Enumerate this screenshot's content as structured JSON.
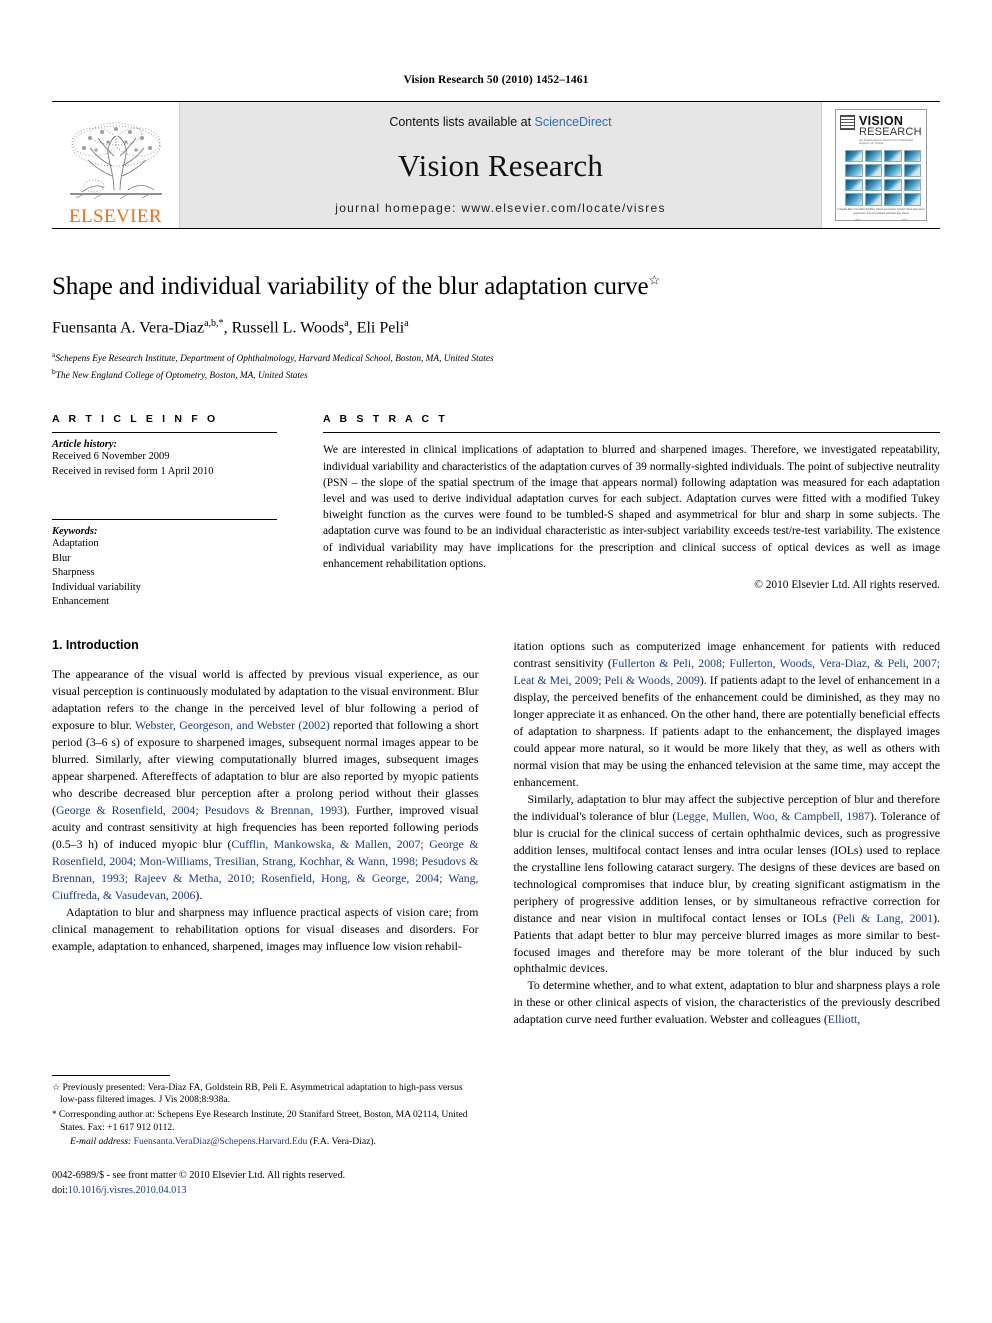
{
  "running_head": "Vision Research 50 (2010) 1452–1461",
  "masthead": {
    "publisher_name": "ELSEVIER",
    "contents_prefix": "Contents lists available at ",
    "contents_link": "ScienceDirect",
    "journal_title": "Vision Research",
    "homepage": "journal homepage: www.elsevier.com/locate/visres",
    "cover": {
      "title_line1": "VISION",
      "title_line2": "RESEARCH",
      "subtitle": "An International Journal for Functional Aspects of Vision",
      "caption": "Contents lists: Circadian rhythms, Visual perception, Spatial vision and colour appearance, Eye movements and binocular vision"
    },
    "colors": {
      "elsevier_orange": "#E8711A",
      "sciencedirect_blue": "#2a6ebb",
      "masthead_gray": "#e6e6e6"
    }
  },
  "title": {
    "text": "Shape and individual variability of the blur adaptation curve",
    "footnote_symbol": "☆"
  },
  "authors": {
    "list": [
      {
        "name": "Fuensanta A. Vera-Diaz",
        "sup": "a,b,*"
      },
      {
        "name": "Russell L. Woods",
        "sup": "a"
      },
      {
        "name": "Eli Peli",
        "sup": "a"
      }
    ],
    "full_line": "Fuensanta A. Vera-Diaz a,b,*, Russell L. Woods a, Eli Peli a"
  },
  "affiliations": [
    {
      "sup": "a",
      "text": "Schepens Eye Research Institute, Department of Ophthalmology, Harvard Medical School, Boston, MA, United States"
    },
    {
      "sup": "b",
      "text": "The New England College of Optometry, Boston, MA, United States"
    }
  ],
  "article_info": {
    "heading": "A R T I C L E   I N F O",
    "history_label": "Article history:",
    "history_lines": [
      "Received 6 November 2009",
      "Received in revised form 1 April 2010"
    ],
    "keywords_label": "Keywords:",
    "keywords": [
      "Adaptation",
      "Blur",
      "Sharpness",
      "Individual variability",
      "Enhancement"
    ]
  },
  "abstract": {
    "heading": "A B S T R A C T",
    "text": "We are interested in clinical implications of adaptation to blurred and sharpened images. Therefore, we investigated repeatability, individual variability and characteristics of the adaptation curves of 39 normally-sighted individuals. The point of subjective neutrality (PSN – the slope of the spatial spectrum of the image that appears normal) following adaptation was measured for each adaptation level and was used to derive individual adaptation curves for each subject. Adaptation curves were fitted with a modified Tukey biweight function as the curves were found to be tumbled-S shaped and asymmetrical for blur and sharp in some subjects. The adaptation curve was found to be an individual characteristic as inter-subject variability exceeds test/re-test variability. The existence of individual variability may have implications for the prescription and clinical success of optical devices as well as image enhancement rehabilitation options.",
    "copyright": "© 2010 Elsevier Ltd. All rights reserved."
  },
  "introduction": {
    "heading": "1. Introduction",
    "left_paragraphs": [
      "The appearance of the visual world is affected by previous visual experience, as our visual perception is continuously modulated by adaptation to the visual environment. Blur adaptation refers to the change in the perceived level of blur following a period of exposure to blur. ##Webster, Georgeson, and Webster (2002)## reported that following a short period (3–6 s) of exposure to sharpened images, subsequent normal images appear to be blurred. Similarly, after viewing computationally blurred images, subsequent images appear sharpened. Aftereffects of adaptation to blur are also reported by myopic patients who describe decreased blur perception after a prolong period without their glasses (##George & Rosenfield, 2004; Pesudovs & Brennan, 1993##). Further, improved visual acuity and contrast sensitivity at high frequencies has been reported following periods (0.5–3 h) of induced myopic blur (##Cufflin, Mankowska, & Mallen, 2007; George & Rosenfield, 2004; Mon-Williams, Tresilian, Strang, Kochhar, & Wann, 1998; Pesudovs & Brennan, 1993; Rajeev & Metha, 2010; Rosenfield, Hong, & George, 2004; Wang, Ciuffreda, & Vasudevan, 2006##).",
      "Adaptation to blur and sharpness may influence practical aspects of vision care; from clinical management to rehabilitation options for visual diseases and disorders. For example, adaptation to enhanced, sharpened, images may influence low vision rehabil-"
    ],
    "right_paragraphs": [
      "itation options such as computerized image enhancement for patients with reduced contrast sensitivity (##Fullerton & Peli, 2008; Fullerton, Woods, Vera-Diaz, & Peli, 2007; Leat & Mei, 2009; Peli & Woods, 2009##). If patients adapt to the level of enhancement in a display, the perceived benefits of the enhancement could be diminished, as they may no longer appreciate it as enhanced. On the other hand, there are potentially beneficial effects of adaptation to sharpness. If patients adapt to the enhancement, the displayed images could appear more natural, so it would be more likely that they, as well as others with normal vision that may be using the enhanced television at the same time, may accept the enhancement.",
      "Similarly, adaptation to blur may affect the subjective perception of blur and therefore the individual's tolerance of blur (##Legge, Mullen, Woo, & Campbell, 1987##). Tolerance of blur is crucial for the clinical success of certain ophthalmic devices, such as progressive addition lenses, multifocal contact lenses and intra ocular lenses (IOLs) used to replace the crystalline lens following cataract surgery. The designs of these devices are based on technological compromises that induce blur, by creating significant astigmatism in the periphery of progressive addition lenses, or by simultaneous refractive correction for distance and near vision in multifocal contact lenses or IOLs (##Peli & Lang, 2001##). Patients that adapt better to blur may perceive blurred images as more similar to best-focused images and therefore may be more tolerant of the blur induced by such ophthalmic devices.",
      "To determine whether, and to what extent, adaptation to blur and sharpness plays a role in these or other clinical aspects of vision, the characteristics of the previously described adaptation curve need further evaluation. Webster and colleagues (##Elliott,##"
    ]
  },
  "footnotes": {
    "previously_presented": "Previously presented: Vera-Diaz FA, Goldstein RB, Peli E. Asymmetrical adaptation to high-pass versus low-pass filtered images. J Vis 2008;8:938a.",
    "previously_presented_symbol": "☆",
    "corresponding": "Corresponding author at: Schepens Eye Research Institute, 20 Stanifard Street, Boston, MA 02114, United States. Fax: +1 617 912 0112.",
    "corresponding_symbol": "*",
    "email_label": "E-mail address:",
    "email_address": "Fuensanta.VeraDiaz@Schepens.Harvard.Edu",
    "email_suffix": "(F.A. Vera-Diaz)."
  },
  "footer": {
    "issn_line": "0042-6989/$ - see front matter © 2010 Elsevier Ltd. All rights reserved.",
    "doi_label": "doi:",
    "doi_value": "10.1016/j.visres.2010.04.013"
  }
}
